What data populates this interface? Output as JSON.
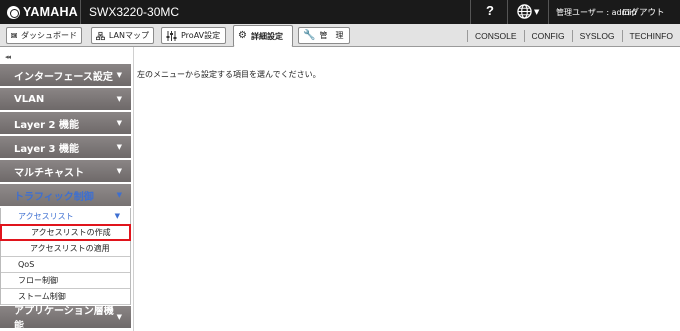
{
  "header": {
    "brand": "YAMAHA",
    "model": "SWX3220-30MC",
    "help": "?",
    "user_label": "管理ユーザー : admin",
    "logout": "ログアウト"
  },
  "toolbar": {
    "buttons": [
      {
        "label": "ダッシュボード",
        "icon": "dashboard-icon"
      },
      {
        "label": "LANマップ",
        "icon": "lan-map-icon"
      },
      {
        "label": "ProAV設定",
        "icon": "proav-icon"
      },
      {
        "label": "詳細設定",
        "icon": "gear-icon",
        "active": true
      },
      {
        "label": "管　理",
        "icon": "wrench-icon"
      }
    ],
    "links": [
      "CONSOLE",
      "CONFIG",
      "SYSLOG",
      "TECHINFO"
    ]
  },
  "sidebar": {
    "collapse": "◂◂",
    "categories": [
      {
        "label": "インターフェース設定"
      },
      {
        "label": "VLAN"
      },
      {
        "label": "Layer 2 機能"
      },
      {
        "label": "Layer 3 機能"
      },
      {
        "label": "マルチキャスト"
      },
      {
        "label": "トラフィック制御",
        "open": true
      }
    ],
    "submenu": {
      "head": "アクセスリスト",
      "items": [
        {
          "label": "アクセスリストの作成",
          "selected": true
        },
        {
          "label": "アクセスリストの適用"
        }
      ],
      "siblings": [
        "QoS",
        "フロー制御",
        "ストーム制御"
      ]
    },
    "last_category": "アプリケーション層機能"
  },
  "main": {
    "message": "左のメニューから設定する項目を選んでください。"
  },
  "colors": {
    "topbar": "#1a1a1a",
    "sidebar_category": "#7a7575",
    "accent_blue": "#3d6fd1",
    "selection_red": "#e0141c"
  }
}
